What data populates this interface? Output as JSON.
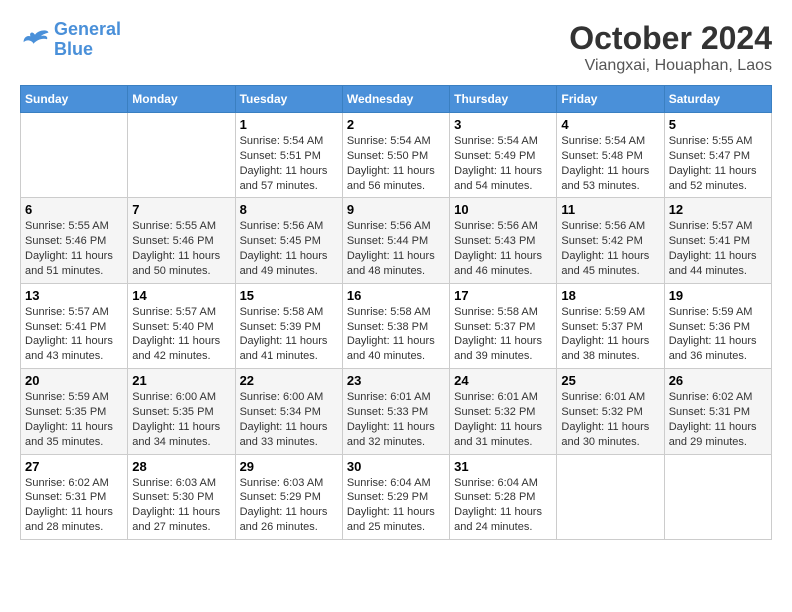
{
  "header": {
    "logo_line1": "General",
    "logo_line2": "Blue",
    "month": "October 2024",
    "location": "Viangxai, Houaphan, Laos"
  },
  "weekdays": [
    "Sunday",
    "Monday",
    "Tuesday",
    "Wednesday",
    "Thursday",
    "Friday",
    "Saturday"
  ],
  "weeks": [
    [
      {
        "day": "",
        "sunrise": "",
        "sunset": "",
        "daylight": ""
      },
      {
        "day": "",
        "sunrise": "",
        "sunset": "",
        "daylight": ""
      },
      {
        "day": "1",
        "sunrise": "Sunrise: 5:54 AM",
        "sunset": "Sunset: 5:51 PM",
        "daylight": "Daylight: 11 hours and 57 minutes."
      },
      {
        "day": "2",
        "sunrise": "Sunrise: 5:54 AM",
        "sunset": "Sunset: 5:50 PM",
        "daylight": "Daylight: 11 hours and 56 minutes."
      },
      {
        "day": "3",
        "sunrise": "Sunrise: 5:54 AM",
        "sunset": "Sunset: 5:49 PM",
        "daylight": "Daylight: 11 hours and 54 minutes."
      },
      {
        "day": "4",
        "sunrise": "Sunrise: 5:54 AM",
        "sunset": "Sunset: 5:48 PM",
        "daylight": "Daylight: 11 hours and 53 minutes."
      },
      {
        "day": "5",
        "sunrise": "Sunrise: 5:55 AM",
        "sunset": "Sunset: 5:47 PM",
        "daylight": "Daylight: 11 hours and 52 minutes."
      }
    ],
    [
      {
        "day": "6",
        "sunrise": "Sunrise: 5:55 AM",
        "sunset": "Sunset: 5:46 PM",
        "daylight": "Daylight: 11 hours and 51 minutes."
      },
      {
        "day": "7",
        "sunrise": "Sunrise: 5:55 AM",
        "sunset": "Sunset: 5:46 PM",
        "daylight": "Daylight: 11 hours and 50 minutes."
      },
      {
        "day": "8",
        "sunrise": "Sunrise: 5:56 AM",
        "sunset": "Sunset: 5:45 PM",
        "daylight": "Daylight: 11 hours and 49 minutes."
      },
      {
        "day": "9",
        "sunrise": "Sunrise: 5:56 AM",
        "sunset": "Sunset: 5:44 PM",
        "daylight": "Daylight: 11 hours and 48 minutes."
      },
      {
        "day": "10",
        "sunrise": "Sunrise: 5:56 AM",
        "sunset": "Sunset: 5:43 PM",
        "daylight": "Daylight: 11 hours and 46 minutes."
      },
      {
        "day": "11",
        "sunrise": "Sunrise: 5:56 AM",
        "sunset": "Sunset: 5:42 PM",
        "daylight": "Daylight: 11 hours and 45 minutes."
      },
      {
        "day": "12",
        "sunrise": "Sunrise: 5:57 AM",
        "sunset": "Sunset: 5:41 PM",
        "daylight": "Daylight: 11 hours and 44 minutes."
      }
    ],
    [
      {
        "day": "13",
        "sunrise": "Sunrise: 5:57 AM",
        "sunset": "Sunset: 5:41 PM",
        "daylight": "Daylight: 11 hours and 43 minutes."
      },
      {
        "day": "14",
        "sunrise": "Sunrise: 5:57 AM",
        "sunset": "Sunset: 5:40 PM",
        "daylight": "Daylight: 11 hours and 42 minutes."
      },
      {
        "day": "15",
        "sunrise": "Sunrise: 5:58 AM",
        "sunset": "Sunset: 5:39 PM",
        "daylight": "Daylight: 11 hours and 41 minutes."
      },
      {
        "day": "16",
        "sunrise": "Sunrise: 5:58 AM",
        "sunset": "Sunset: 5:38 PM",
        "daylight": "Daylight: 11 hours and 40 minutes."
      },
      {
        "day": "17",
        "sunrise": "Sunrise: 5:58 AM",
        "sunset": "Sunset: 5:37 PM",
        "daylight": "Daylight: 11 hours and 39 minutes."
      },
      {
        "day": "18",
        "sunrise": "Sunrise: 5:59 AM",
        "sunset": "Sunset: 5:37 PM",
        "daylight": "Daylight: 11 hours and 38 minutes."
      },
      {
        "day": "19",
        "sunrise": "Sunrise: 5:59 AM",
        "sunset": "Sunset: 5:36 PM",
        "daylight": "Daylight: 11 hours and 36 minutes."
      }
    ],
    [
      {
        "day": "20",
        "sunrise": "Sunrise: 5:59 AM",
        "sunset": "Sunset: 5:35 PM",
        "daylight": "Daylight: 11 hours and 35 minutes."
      },
      {
        "day": "21",
        "sunrise": "Sunrise: 6:00 AM",
        "sunset": "Sunset: 5:35 PM",
        "daylight": "Daylight: 11 hours and 34 minutes."
      },
      {
        "day": "22",
        "sunrise": "Sunrise: 6:00 AM",
        "sunset": "Sunset: 5:34 PM",
        "daylight": "Daylight: 11 hours and 33 minutes."
      },
      {
        "day": "23",
        "sunrise": "Sunrise: 6:01 AM",
        "sunset": "Sunset: 5:33 PM",
        "daylight": "Daylight: 11 hours and 32 minutes."
      },
      {
        "day": "24",
        "sunrise": "Sunrise: 6:01 AM",
        "sunset": "Sunset: 5:32 PM",
        "daylight": "Daylight: 11 hours and 31 minutes."
      },
      {
        "day": "25",
        "sunrise": "Sunrise: 6:01 AM",
        "sunset": "Sunset: 5:32 PM",
        "daylight": "Daylight: 11 hours and 30 minutes."
      },
      {
        "day": "26",
        "sunrise": "Sunrise: 6:02 AM",
        "sunset": "Sunset: 5:31 PM",
        "daylight": "Daylight: 11 hours and 29 minutes."
      }
    ],
    [
      {
        "day": "27",
        "sunrise": "Sunrise: 6:02 AM",
        "sunset": "Sunset: 5:31 PM",
        "daylight": "Daylight: 11 hours and 28 minutes."
      },
      {
        "day": "28",
        "sunrise": "Sunrise: 6:03 AM",
        "sunset": "Sunset: 5:30 PM",
        "daylight": "Daylight: 11 hours and 27 minutes."
      },
      {
        "day": "29",
        "sunrise": "Sunrise: 6:03 AM",
        "sunset": "Sunset: 5:29 PM",
        "daylight": "Daylight: 11 hours and 26 minutes."
      },
      {
        "day": "30",
        "sunrise": "Sunrise: 6:04 AM",
        "sunset": "Sunset: 5:29 PM",
        "daylight": "Daylight: 11 hours and 25 minutes."
      },
      {
        "day": "31",
        "sunrise": "Sunrise: 6:04 AM",
        "sunset": "Sunset: 5:28 PM",
        "daylight": "Daylight: 11 hours and 24 minutes."
      },
      {
        "day": "",
        "sunrise": "",
        "sunset": "",
        "daylight": ""
      },
      {
        "day": "",
        "sunrise": "",
        "sunset": "",
        "daylight": ""
      }
    ]
  ]
}
